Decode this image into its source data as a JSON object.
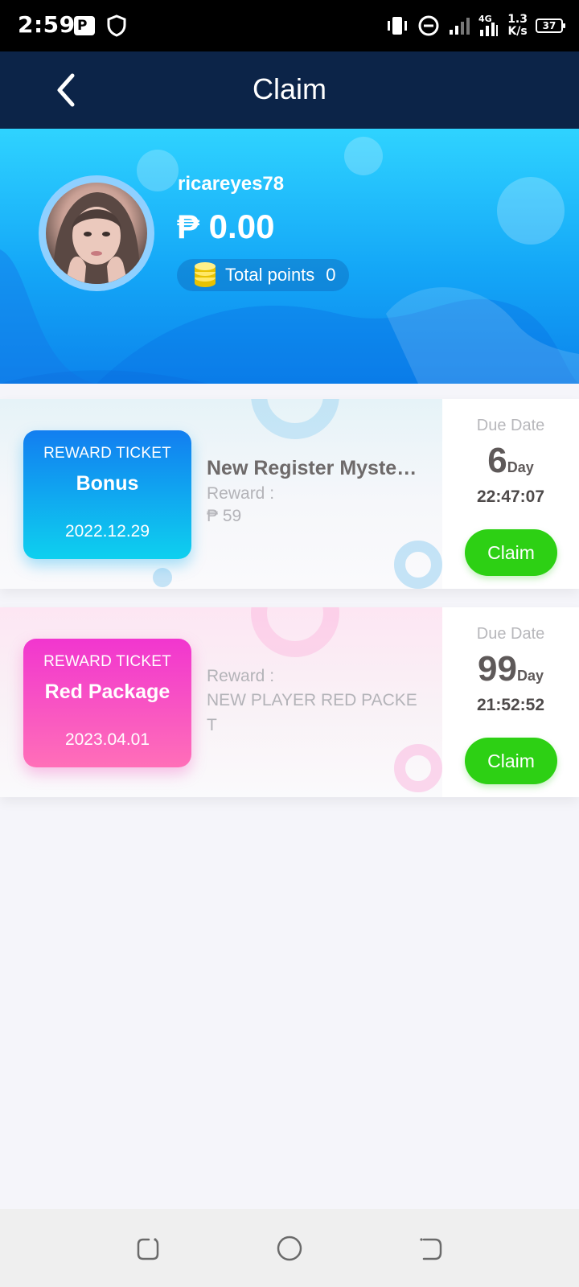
{
  "status_bar": {
    "time": "2:59",
    "speed_value": "1.3",
    "speed_unit": "K/s",
    "network": "4G",
    "battery": "37",
    "icons": [
      "p-icon",
      "shield-icon",
      "vibrate-icon",
      "dnd-icon",
      "signal-icon",
      "4g-icon",
      "battery-icon"
    ]
  },
  "header": {
    "title": "Claim",
    "back_icon": "chevron-left-icon"
  },
  "profile": {
    "username": "ricareyes78",
    "balance": "₱ 0.00",
    "points_label": "Total points",
    "points_value": "0",
    "coins_icon": "coins-icon"
  },
  "rewards": [
    {
      "ticket_type": "REWARD TICKET",
      "ticket_name": "Bonus",
      "ticket_date": "2022.12.29",
      "title": "New Register Mystery Bonus",
      "reward_label": "Reward :",
      "reward_value": "₱ 59",
      "due_label": "Due Date",
      "due_days": "6",
      "due_unit": "Day",
      "due_time": "22:47:07",
      "claim_label": "Claim",
      "theme_color": "#127ef0"
    },
    {
      "ticket_type": "REWARD TICKET",
      "ticket_name": "Red Package",
      "ticket_date": "2023.04.01",
      "title": "",
      "reward_label": "Reward :",
      "reward_value": "NEW PLAYER RED PACKET",
      "due_label": "Due Date",
      "due_days": "99",
      "due_unit": "Day",
      "due_time": "21:52:52",
      "claim_label": "Claim",
      "theme_color": "#f136cf"
    }
  ],
  "nav": {
    "icons": [
      "recents-icon",
      "home-icon",
      "back-icon"
    ]
  },
  "colors": {
    "header_bg": "#0c2448",
    "banner_top": "#2fd3ff",
    "banner_bottom": "#0c84ec",
    "claim_green": "#2dd014"
  }
}
